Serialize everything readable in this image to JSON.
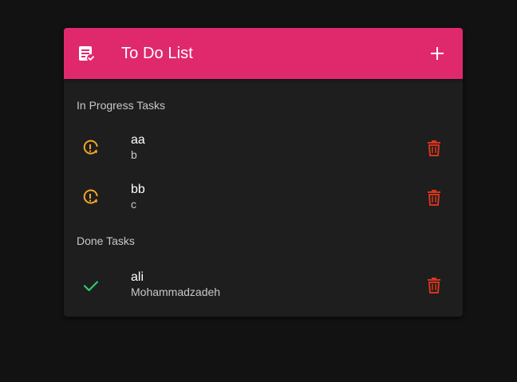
{
  "header": {
    "title": "To Do List",
    "app_icon": "notes-check-icon",
    "add_icon": "plus-icon"
  },
  "colors": {
    "background": "#121212",
    "card": "#1e1e1e",
    "accent": "#e0296d",
    "in_progress": "#f5a623",
    "done": "#2ecc71",
    "delete": "#d8351b"
  },
  "sections": {
    "in_progress": {
      "label": "In Progress Tasks",
      "items": [
        {
          "title": "aa",
          "subtitle": "b",
          "icon": "pending-clock-icon",
          "action_icon": "trash-icon"
        },
        {
          "title": "bb",
          "subtitle": "c",
          "icon": "pending-clock-icon",
          "action_icon": "trash-icon"
        }
      ]
    },
    "done": {
      "label": "Done Tasks",
      "items": [
        {
          "title": "ali",
          "subtitle": "Mohammadzadeh",
          "icon": "check-icon",
          "action_icon": "trash-icon"
        }
      ]
    }
  }
}
